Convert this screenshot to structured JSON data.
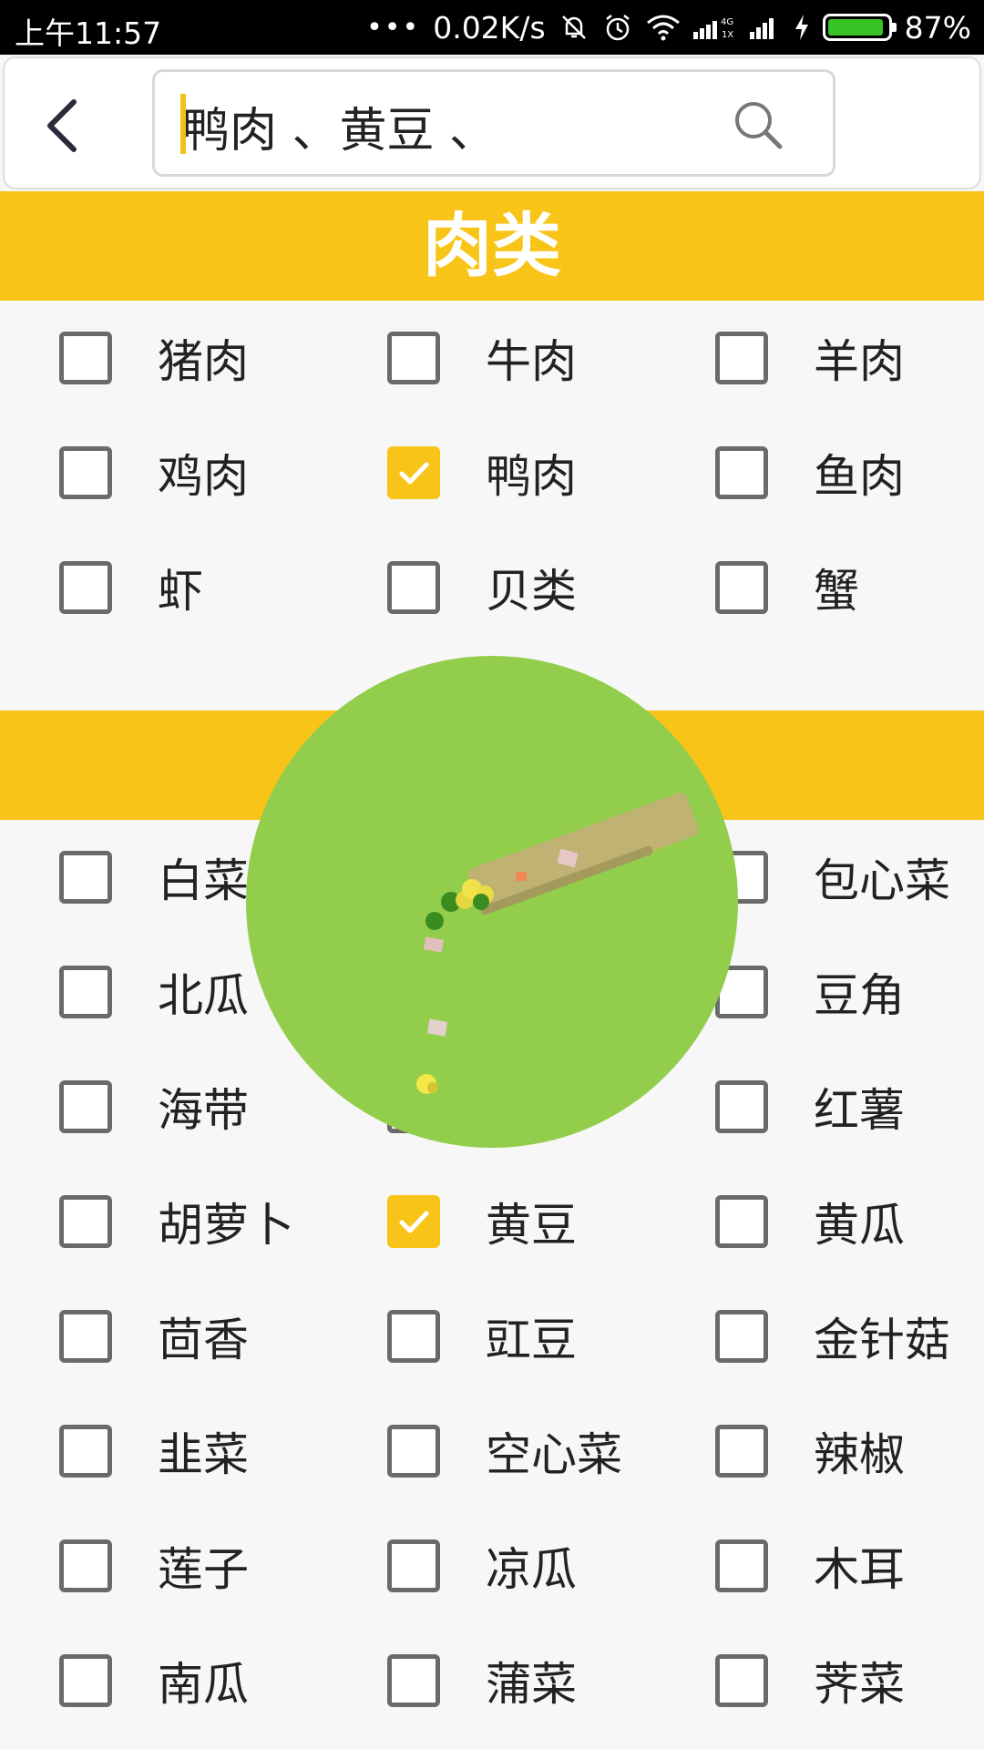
{
  "status_bar": {
    "time": "上午11:57",
    "net_speed": "0.02K/s",
    "battery": "87%",
    "network_type": "4G"
  },
  "header": {
    "search_value": "鸭肉 、黄豆 、"
  },
  "sections": [
    {
      "title": "肉类"
    },
    {
      "title": ""
    }
  ],
  "meat_items": [
    {
      "label": "猪肉",
      "checked": false
    },
    {
      "label": "牛肉",
      "checked": false
    },
    {
      "label": "羊肉",
      "checked": false
    },
    {
      "label": "鸡肉",
      "checked": false
    },
    {
      "label": "鸭肉",
      "checked": true
    },
    {
      "label": "鱼肉",
      "checked": false
    },
    {
      "label": "虾",
      "checked": false
    },
    {
      "label": "贝类",
      "checked": false
    },
    {
      "label": "蟹",
      "checked": false
    }
  ],
  "veg_items": [
    {
      "label": "白菜",
      "checked": false
    },
    {
      "label": "",
      "checked": false
    },
    {
      "label": "包心菜",
      "checked": false
    },
    {
      "label": "北瓜",
      "checked": false
    },
    {
      "label": "",
      "checked": false
    },
    {
      "label": "豆角",
      "checked": false
    },
    {
      "label": "海带",
      "checked": false
    },
    {
      "label": "",
      "checked": false
    },
    {
      "label": "红薯",
      "checked": false
    },
    {
      "label": "胡萝卜",
      "checked": false
    },
    {
      "label": "黄豆",
      "checked": true
    },
    {
      "label": "黄瓜",
      "checked": false
    },
    {
      "label": "茴香",
      "checked": false
    },
    {
      "label": "豇豆",
      "checked": false
    },
    {
      "label": "金针菇",
      "checked": false
    },
    {
      "label": "韭菜",
      "checked": false
    },
    {
      "label": "空心菜",
      "checked": false
    },
    {
      "label": "辣椒",
      "checked": false
    },
    {
      "label": "莲子",
      "checked": false
    },
    {
      "label": "凉瓜",
      "checked": false
    },
    {
      "label": "木耳",
      "checked": false
    },
    {
      "label": "南瓜",
      "checked": false
    },
    {
      "label": "蒲菜",
      "checked": false
    },
    {
      "label": "荠菜",
      "checked": false
    }
  ],
  "colors": {
    "accent": "#f8c417",
    "overlay": "#92cd4c",
    "checkbox_border": "#6a6a6a"
  },
  "icons": [
    "back-arrow-icon",
    "search-icon",
    "check-icon",
    "wifi-icon",
    "alarm-icon",
    "mute-icon",
    "signal-icon",
    "charging-icon",
    "battery-icon",
    "cooking-animation"
  ]
}
